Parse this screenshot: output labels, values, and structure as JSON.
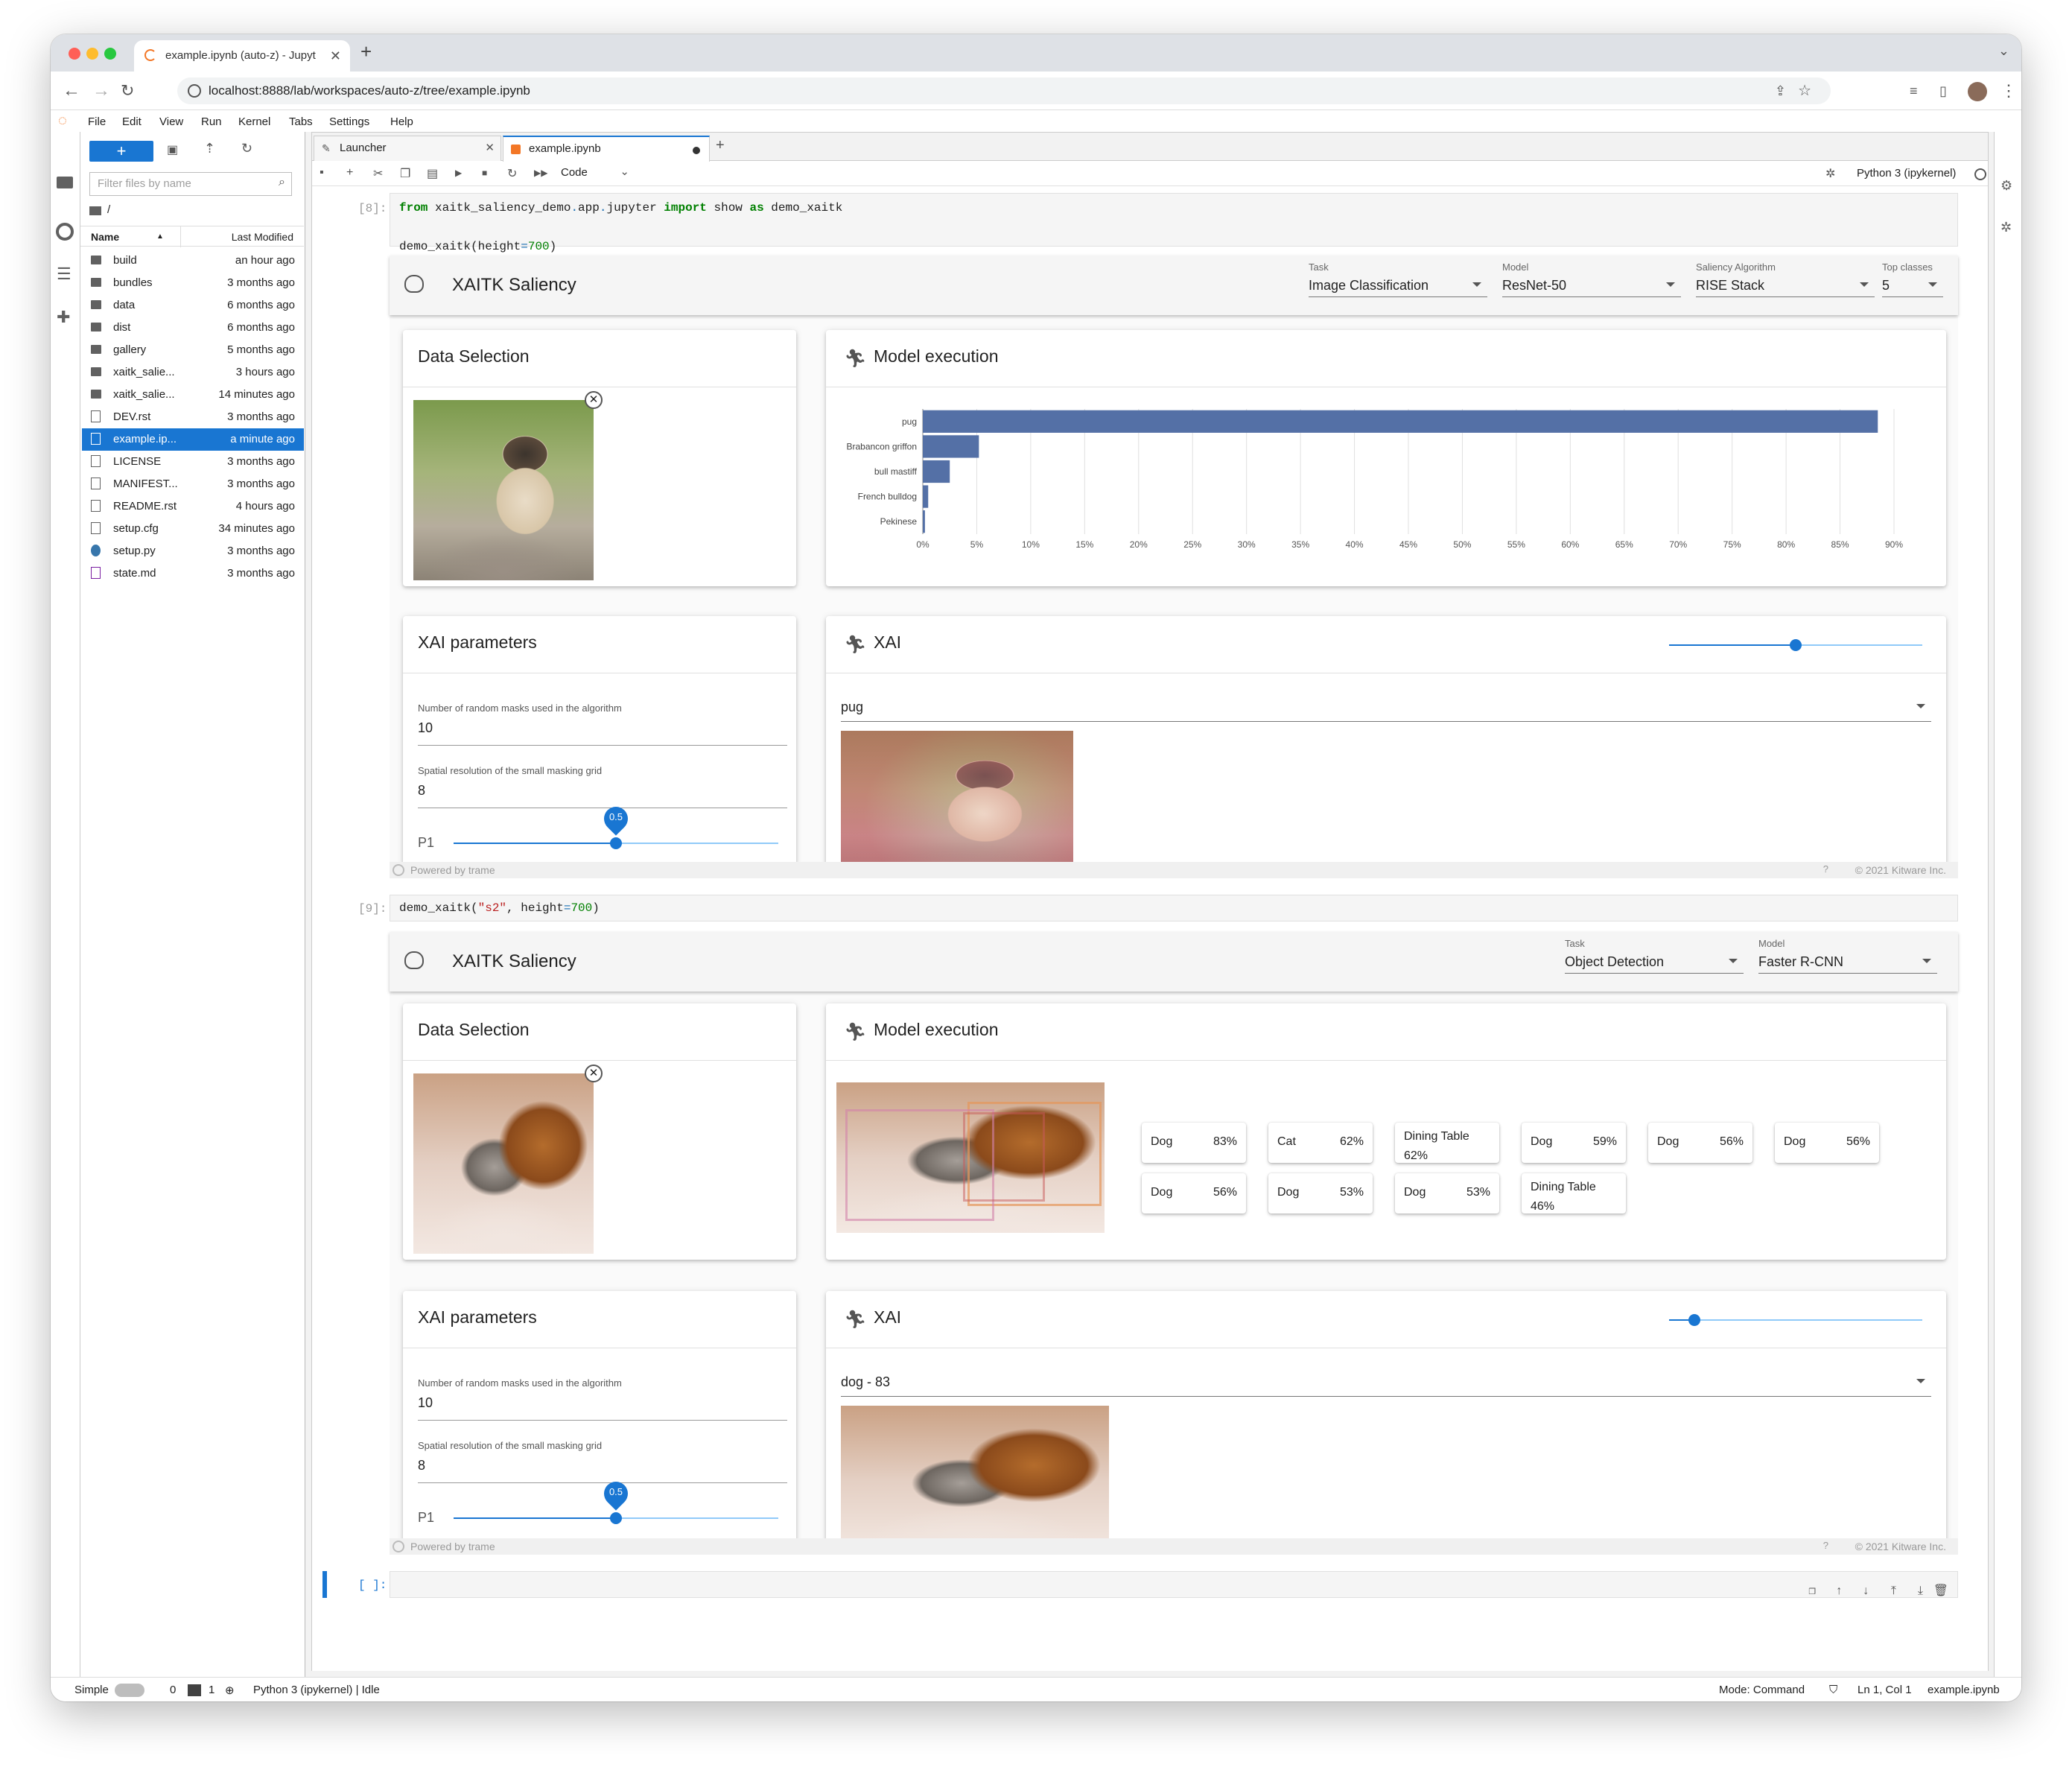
{
  "browser": {
    "tab_title": "example.ipynb (auto-z) - Jupyt",
    "url": "localhost:8888/lab/workspaces/auto-z/tree/example.ipynb",
    "new_tab": "+"
  },
  "menu": [
    "File",
    "Edit",
    "Run",
    "Kernel",
    "Tabs",
    "Settings",
    "Help"
  ],
  "filebrowser": {
    "filter_placeholder": "Filter files by name",
    "path": "/",
    "col_name": "Name",
    "col_modified": "Last Modified",
    "files": [
      {
        "name": "build",
        "modified": "an hour ago",
        "type": "folder"
      },
      {
        "name": "bundles",
        "modified": "3 months ago",
        "type": "folder"
      },
      {
        "name": "data",
        "modified": "6 months ago",
        "type": "folder"
      },
      {
        "name": "dist",
        "modified": "6 months ago",
        "type": "folder"
      },
      {
        "name": "gallery",
        "modified": "5 months ago",
        "type": "folder"
      },
      {
        "name": "xaitk_salie...",
        "modified": "3 hours ago",
        "type": "folder"
      },
      {
        "name": "xaitk_salie...",
        "modified": "14 minutes ago",
        "type": "folder"
      },
      {
        "name": "DEV.rst",
        "modified": "3 months ago",
        "type": "file"
      },
      {
        "name": "example.ip...",
        "modified": "a minute ago",
        "type": "notebook"
      },
      {
        "name": "LICENSE",
        "modified": "3 months ago",
        "type": "file"
      },
      {
        "name": "MANIFEST...",
        "modified": "3 months ago",
        "type": "file"
      },
      {
        "name": "README.rst",
        "modified": "4 hours ago",
        "type": "file"
      },
      {
        "name": "setup.cfg",
        "modified": "34 minutes ago",
        "type": "file"
      },
      {
        "name": "setup.py",
        "modified": "3 months ago",
        "type": "python"
      },
      {
        "name": "state.md",
        "modified": "3 months ago",
        "type": "markdown"
      }
    ]
  },
  "notebook": {
    "tabs": [
      "Launcher",
      "example.ipynb"
    ],
    "celltype": "Code",
    "kernel": "Python 3 (ipykernel)",
    "cell1_prompt": "[8]:",
    "cell2_prompt": "[9]:",
    "cell3_prompt": "[ ]:"
  },
  "app1": {
    "title": "XAITK Saliency",
    "task_label": "Task",
    "task": "Image Classification",
    "model_label": "Model",
    "model": "ResNet-50",
    "saliency_label": "Saliency Algorithm",
    "saliency": "RISE Stack",
    "top_label": "Top classes",
    "top": "5",
    "data_title": "Data Selection",
    "exec_title": "Model execution",
    "params_title": "XAI parameters",
    "xai_title": "XAI",
    "masks_label": "Number of random masks used in the algorithm",
    "masks": "10",
    "grid_label": "Spatial resolution of the small masking grid",
    "grid": "8",
    "p1_label": "P1",
    "p1": "0.5",
    "xai_class": "pug",
    "xai_slider": 0.6,
    "powered": "Powered by trame",
    "copyright": "© 2021 Kitware Inc."
  },
  "chart_data": {
    "type": "bar",
    "orientation": "horizontal",
    "categories": [
      "pug",
      "Brabancon griffon",
      "bull mastiff",
      "French bulldog",
      "Pekinese"
    ],
    "values": [
      88.5,
      5.2,
      2.5,
      0.5,
      0.2
    ],
    "xlim": [
      0,
      90
    ],
    "xticks": [
      "0%",
      "5%",
      "10%",
      "15%",
      "20%",
      "25%",
      "30%",
      "35%",
      "40%",
      "45%",
      "50%",
      "55%",
      "60%",
      "65%",
      "70%",
      "75%",
      "80%",
      "85%",
      "90%"
    ],
    "grid": true,
    "color": "#5470a6"
  },
  "app2": {
    "title": "XAITK Saliency",
    "task_label": "Task",
    "task": "Object Detection",
    "model_label": "Model",
    "model": "Faster R-CNN",
    "data_title": "Data Selection",
    "exec_title": "Model execution",
    "params_title": "XAI parameters",
    "xai_title": "XAI",
    "masks_label": "Number of random masks used in the algorithm",
    "masks": "10",
    "grid_label": "Spatial resolution of the small masking grid",
    "grid": "8",
    "p1_label": "P1",
    "p1": "0.5",
    "xai_class": "dog - 83",
    "xai_slider": 0.1,
    "powered": "Powered by trame",
    "copyright": "© 2021 Kitware Inc.",
    "detections": [
      {
        "label": "Dog",
        "pct": "83%"
      },
      {
        "label": "Cat",
        "pct": "62%"
      },
      {
        "label": "Dining Table",
        "pct": "62%"
      },
      {
        "label": "Dog",
        "pct": "59%"
      },
      {
        "label": "Dog",
        "pct": "56%"
      },
      {
        "label": "Dog",
        "pct": "56%"
      },
      {
        "label": "Dog",
        "pct": "56%"
      },
      {
        "label": "Dog",
        "pct": "53%"
      },
      {
        "label": "Dog",
        "pct": "53%"
      },
      {
        "label": "Dining Table",
        "pct": "46%"
      }
    ]
  },
  "status": {
    "simple": "Simple",
    "zero": "0",
    "one": "1",
    "kernel": "Python 3 (ipykernel) | Idle",
    "mode": "Mode: Command",
    "cursor": "Ln 1, Col 1",
    "file": "example.ipynb"
  }
}
